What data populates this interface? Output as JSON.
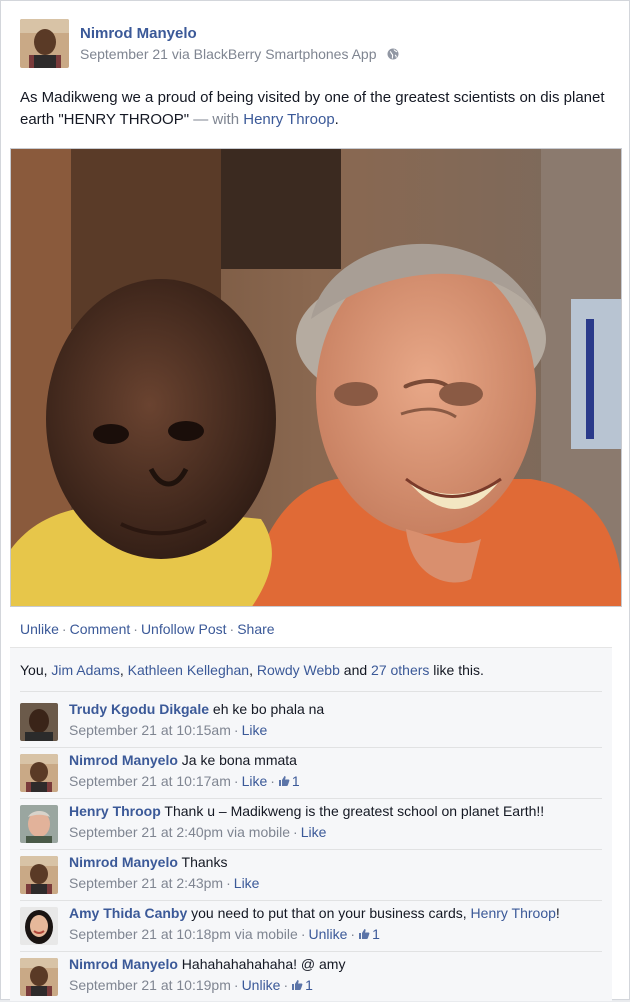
{
  "post": {
    "author": "Nimrod Manyelo",
    "meta": "September 21 via BlackBerry Smartphones App",
    "status_text": "As Madikweng we a proud of being visited by one of the greatest scientists on dis planet earth \"HENRY THROOP\"",
    "with_prefix": " — with ",
    "tagged": "Henry Throop",
    "tagged_suffix": "."
  },
  "actions": {
    "unlike": "Unlike",
    "comment": "Comment",
    "unfollow": "Unfollow Post",
    "share": "Share",
    "separator": "·"
  },
  "likes": {
    "you": "You, ",
    "name1": "Jim Adams",
    "comma1": ", ",
    "name2": "Kathleen Kelleghan",
    "comma2": ", ",
    "name3": "Rowdy Webb",
    "and": " and ",
    "others": "27 others",
    "suffix": " like this."
  },
  "comments": [
    {
      "name": "Trudy Kgodu Dikgale",
      "text": " eh ke bo phala na",
      "tagged": "",
      "text_after": "",
      "time": "September 21 at 10:15am",
      "via": "",
      "action": "Like",
      "like_count": "",
      "avatar": "man-dark"
    },
    {
      "name": "Nimrod Manyelo",
      "text": " Ja ke bona mmata",
      "tagged": "",
      "text_after": "",
      "time": "September 21 at 10:17am",
      "via": "",
      "action": "Like",
      "like_count": "1",
      "avatar": "nimrod"
    },
    {
      "name": "Henry Throop",
      "text": " Thank u – Madikweng is the greatest school on planet Earth!!",
      "tagged": "",
      "text_after": "",
      "time": "September 21 at 2:40pm",
      "via": " via mobile",
      "action": "Like",
      "like_count": "",
      "avatar": "henry"
    },
    {
      "name": "Nimrod Manyelo",
      "text": " Thanks",
      "tagged": "",
      "text_after": "",
      "time": "September 21 at 2:43pm",
      "via": "",
      "action": "Like",
      "like_count": "",
      "avatar": "nimrod"
    },
    {
      "name": "Amy Thida Canby",
      "text": " you need to put that on your business cards, ",
      "tagged": "Henry Throop",
      "text_after": "!",
      "time": "September 21 at 10:18pm",
      "via": " via mobile",
      "action": "Unlike",
      "like_count": "1",
      "avatar": "amy"
    },
    {
      "name": "Nimrod Manyelo",
      "text": " Hahahahahahaha! @ amy",
      "tagged": "",
      "text_after": "",
      "time": "September 21 at 10:19pm",
      "via": "",
      "action": "Unlike",
      "like_count": "1",
      "avatar": "nimrod"
    }
  ],
  "colors": {
    "link": "#3b5998",
    "meta": "#7f8591",
    "feedback_bg": "#f6f7f9"
  },
  "icons": {
    "privacy": "globe-icon",
    "like_count": "thumbs-up-icon"
  }
}
